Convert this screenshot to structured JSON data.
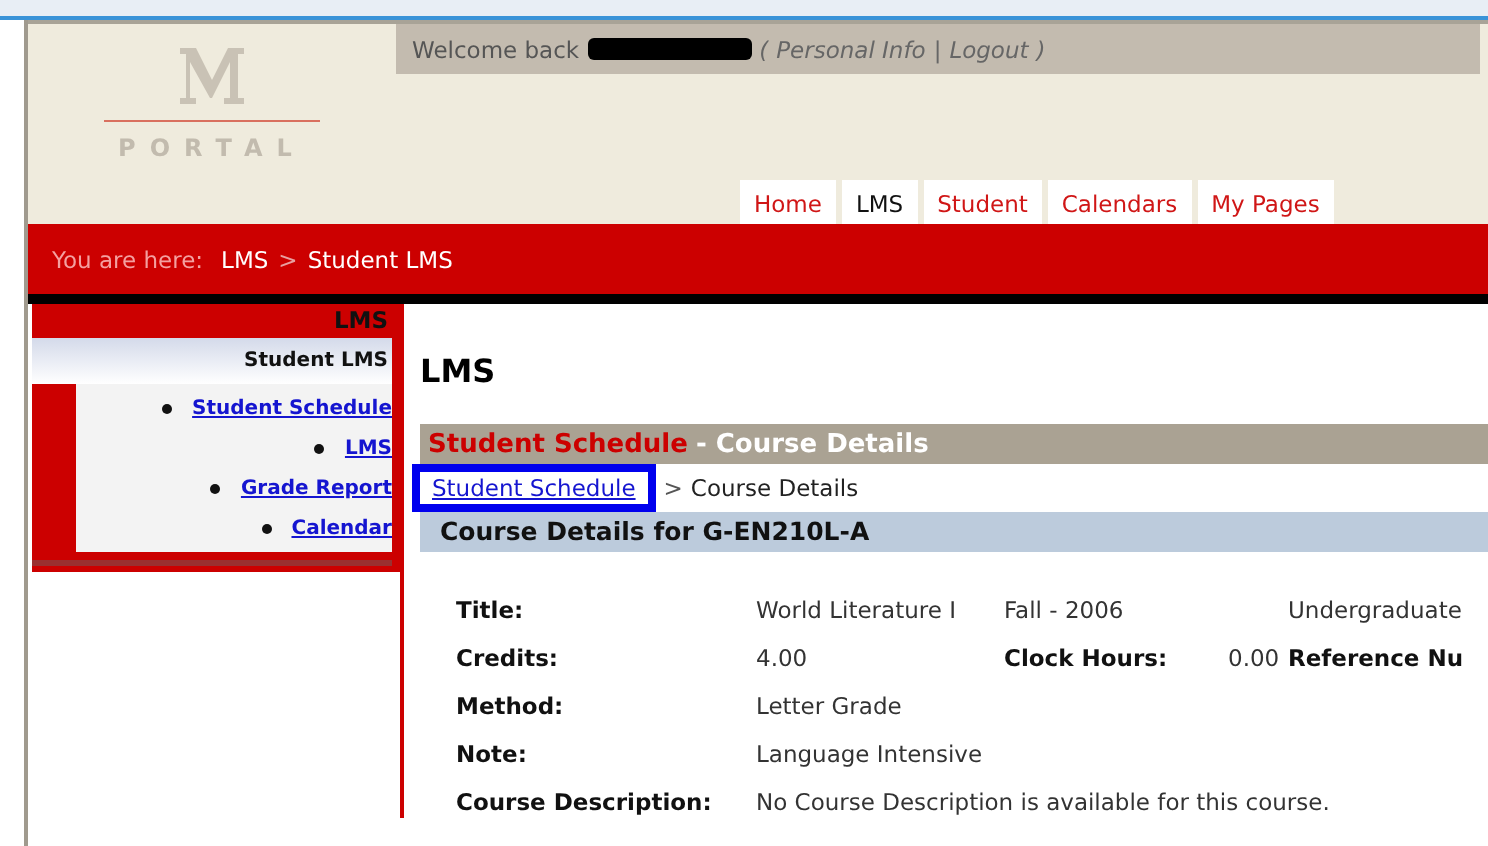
{
  "logo": {
    "text": "PORTAL"
  },
  "welcome": {
    "greeting": "Welcome back",
    "open": "(",
    "links": [
      "Personal Info",
      "Logout"
    ],
    "divider": "|",
    "close": ")",
    "name_redacted": true
  },
  "tabs": [
    {
      "label": "Home",
      "selected": false
    },
    {
      "label": "LMS",
      "selected": true
    },
    {
      "label": "Student",
      "selected": false
    },
    {
      "label": "Calendars",
      "selected": false
    },
    {
      "label": "My Pages",
      "selected": false
    }
  ],
  "location": {
    "label": "You are here:",
    "items": [
      "LMS",
      "Student LMS"
    ],
    "separator": ">"
  },
  "sidebar": {
    "heading": "LMS",
    "subheading": "Student LMS",
    "items": [
      {
        "label": "Student Schedule",
        "children": [
          {
            "label": "LMS"
          }
        ]
      },
      {
        "label": "Grade Report",
        "children": [
          {
            "label": "Calendar"
          }
        ]
      }
    ]
  },
  "main": {
    "title": "LMS",
    "section": {
      "title": "Student Schedule",
      "subtitle": "- Course Details"
    },
    "breadcrumb": {
      "link": "Student Schedule",
      "separator": ">",
      "current": "Course Details",
      "highlighted": true
    },
    "details_header": "Course Details for G-EN210L-A",
    "rows": [
      [
        {
          "text": "Title:",
          "kind": "label"
        },
        {
          "text": "World Literature I",
          "kind": "value"
        },
        {
          "text": "Fall - 2006",
          "kind": "value"
        },
        {
          "text": ""
        },
        {
          "text": "Undergraduate",
          "kind": "value"
        }
      ],
      [
        {
          "text": "Credits:",
          "kind": "label"
        },
        {
          "text": "4.00",
          "kind": "value"
        },
        {
          "text": "Clock Hours:",
          "kind": "label"
        },
        {
          "text": "0.00",
          "kind": "value"
        },
        {
          "text": "Reference Nu",
          "kind": "label"
        }
      ],
      [
        {
          "text": "Method:",
          "kind": "label"
        },
        {
          "text": "Letter Grade",
          "kind": "value"
        }
      ],
      [
        {
          "text": "Note:",
          "kind": "label"
        },
        {
          "text": "Language Intensive",
          "kind": "value"
        }
      ],
      [
        {
          "text": "Course Description:",
          "kind": "label"
        },
        {
          "text": "No Course Description is available for this course.",
          "kind": "value"
        }
      ]
    ]
  }
}
